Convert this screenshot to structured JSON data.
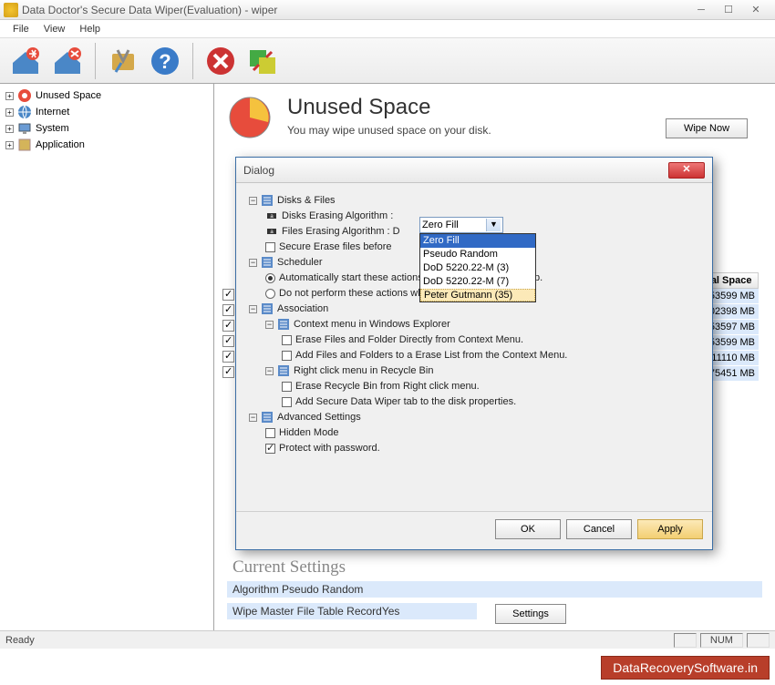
{
  "window": {
    "title": "Data Doctor's Secure Data Wiper(Evaluation) - wiper"
  },
  "menu": {
    "file": "File",
    "view": "View",
    "help": "Help"
  },
  "sidebar": {
    "items": [
      {
        "label": "Unused Space"
      },
      {
        "label": "Internet"
      },
      {
        "label": "System"
      },
      {
        "label": "Application"
      }
    ]
  },
  "header": {
    "title": "Unused Space",
    "subtitle": "You may wipe unused space on your disk.",
    "wipe_now": "Wipe Now"
  },
  "table": {
    "header": "Total Space",
    "rows": [
      "53599 MB",
      "02398 MB",
      "53597 MB",
      "53599 MB",
      "11110 MB",
      "75451 MB"
    ]
  },
  "settings": {
    "current": "Current Settings",
    "algorithm": "Algorithm Pseudo Random",
    "mft": "Wipe Master File Table RecordYes",
    "btn": "Settings"
  },
  "dialog": {
    "title": "Dialog",
    "tree": {
      "disks_files": "Disks & Files",
      "disks_algo": "Disks Erasing Algorithm :",
      "files_algo": "Files Erasing Algorithm : D",
      "secure_erase": "Secure Erase files before",
      "scheduler": "Scheduler",
      "auto_start": "Automatically start these actions when the program startup.",
      "no_auto": "Do not perform these actions when a schedule task starts",
      "association": "Association",
      "ctx_explorer": "Context menu in Windows Explorer",
      "erase_direct": "Erase Files and Folder Directly from Context Menu.",
      "add_files": "Add Files and Folders to a Erase List from the Context Menu.",
      "right_click": "Right click menu in Recycle Bin",
      "erase_bin": "Erase Recycle Bin from Right click menu.",
      "add_tab": "Add Secure Data Wiper tab to the disk properties.",
      "advanced": "Advanced Settings",
      "hidden": "Hidden Mode",
      "protect": "Protect with password."
    },
    "combo": {
      "selected": "Zero Fill",
      "options": [
        "Zero Fill",
        "Pseudo Random",
        "DoD 5220.22-M (3)",
        "DoD 5220.22-M (7)",
        "Peter Gutmann (35)"
      ]
    },
    "buttons": {
      "ok": "OK",
      "cancel": "Cancel",
      "apply": "Apply"
    }
  },
  "status": {
    "ready": "Ready",
    "num": "NUM"
  },
  "watermark": "DataRecoverySoftware.in"
}
